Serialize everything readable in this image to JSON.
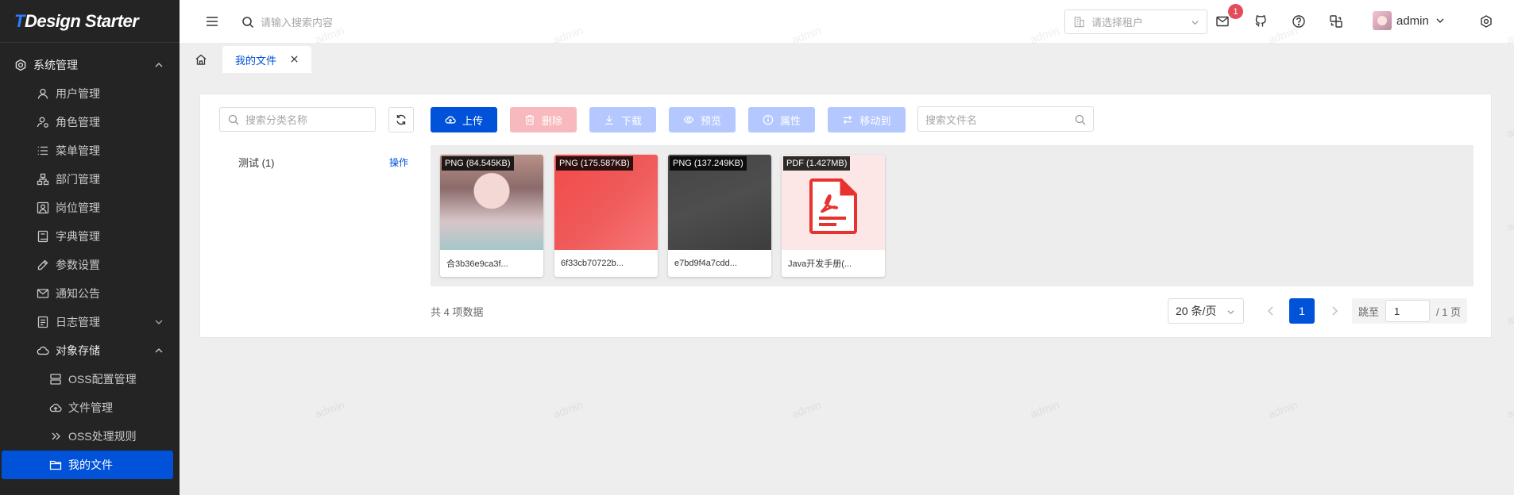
{
  "app": {
    "logo_text": "TDesign Starter",
    "logo_accent": "T",
    "logo_rest": "Design Starter"
  },
  "sidebar": {
    "groups": [
      {
        "label": "系统管理",
        "icon": "settings-icon",
        "expanded": true
      },
      {
        "label": "对象存储",
        "icon": "cloud-icon",
        "expanded": true
      }
    ],
    "system_items": [
      {
        "label": "用户管理",
        "icon": "user-icon"
      },
      {
        "label": "角色管理",
        "icon": "user-role-icon"
      },
      {
        "label": "菜单管理",
        "icon": "list-icon"
      },
      {
        "label": "部门管理",
        "icon": "org-icon"
      },
      {
        "label": "岗位管理",
        "icon": "user-square-icon"
      },
      {
        "label": "字典管理",
        "icon": "book-icon"
      },
      {
        "label": "参数设置",
        "icon": "edit-icon"
      },
      {
        "label": "通知公告",
        "icon": "mail-icon"
      },
      {
        "label": "日志管理",
        "icon": "file-icon"
      }
    ],
    "oss_items": [
      {
        "label": "OSS配置管理",
        "icon": "server-icon"
      },
      {
        "label": "文件管理",
        "icon": "cloud-upload-icon"
      },
      {
        "label": "OSS处理规则",
        "icon": "chevron-right-double-icon"
      },
      {
        "label": "我的文件",
        "icon": "folder-icon",
        "active": true
      }
    ]
  },
  "header": {
    "search_placeholder": "请输入搜索内容",
    "tenant_placeholder": "请选择租户",
    "notification_count": "1",
    "username": "admin"
  },
  "tabs": {
    "active_label": "我的文件"
  },
  "category_panel": {
    "search_placeholder": "搜索分类名称",
    "category_label": "测试 (1)",
    "operation_label": "操作"
  },
  "toolbar": {
    "upload": "上传",
    "delete": "删除",
    "download": "下载",
    "preview": "预览",
    "properties": "属性",
    "move": "移动到",
    "file_search_placeholder": "搜索文件名"
  },
  "files": [
    {
      "tag": "PNG (84.545KB)",
      "name": "合3b36e9ca3f...",
      "thumb": "anime"
    },
    {
      "tag": "PNG (175.587KB)",
      "name": "6f33cb70722b...",
      "thumb": "red"
    },
    {
      "tag": "PNG (137.249KB)",
      "name": "e7bd9f4a7cdd...",
      "thumb": "dark"
    },
    {
      "tag": "PDF (1.427MB)",
      "name": "Java开发手册(...",
      "thumb": "pdf"
    }
  ],
  "pagination": {
    "total_text": "共 4 项数据",
    "page_size": "20 条/页",
    "current_page": "1",
    "jump_label": "跳至",
    "jump_value": "1",
    "total_pages": "/ 1 页"
  },
  "watermark": "admin",
  "colors": {
    "primary": "#0052d9",
    "sidebar_bg": "#242424",
    "badge": "#e34d59"
  }
}
